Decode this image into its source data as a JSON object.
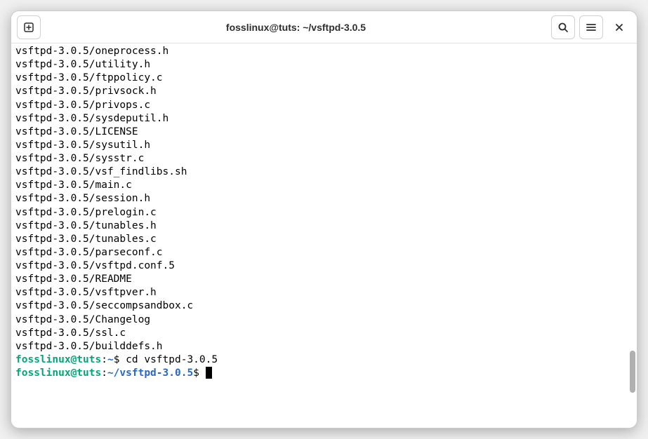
{
  "window": {
    "title": "fosslinux@tuts: ~/vsftpd-3.0.5"
  },
  "terminal": {
    "output_lines": [
      "vsftpd-3.0.5/oneprocess.h",
      "vsftpd-3.0.5/utility.h",
      "vsftpd-3.0.5/ftppolicy.c",
      "vsftpd-3.0.5/privsock.h",
      "vsftpd-3.0.5/privops.c",
      "vsftpd-3.0.5/sysdeputil.h",
      "vsftpd-3.0.5/LICENSE",
      "vsftpd-3.0.5/sysutil.h",
      "vsftpd-3.0.5/sysstr.c",
      "vsftpd-3.0.5/vsf_findlibs.sh",
      "vsftpd-3.0.5/main.c",
      "vsftpd-3.0.5/session.h",
      "vsftpd-3.0.5/prelogin.c",
      "vsftpd-3.0.5/tunables.h",
      "vsftpd-3.0.5/tunables.c",
      "vsftpd-3.0.5/parseconf.c",
      "vsftpd-3.0.5/vsftpd.conf.5",
      "vsftpd-3.0.5/README",
      "vsftpd-3.0.5/vsftpver.h",
      "vsftpd-3.0.5/seccompsandbox.c",
      "vsftpd-3.0.5/Changelog",
      "vsftpd-3.0.5/ssl.c",
      "vsftpd-3.0.5/builddefs.h"
    ],
    "prompt1": {
      "user": "fosslinux@tuts",
      "sep1": ":",
      "path": "~",
      "sep2": "$ ",
      "cmd": "cd vsftpd-3.0.5"
    },
    "prompt2": {
      "user": "fosslinux@tuts",
      "sep1": ":",
      "path": "~/vsftpd-3.0.5",
      "sep2": "$ "
    }
  }
}
